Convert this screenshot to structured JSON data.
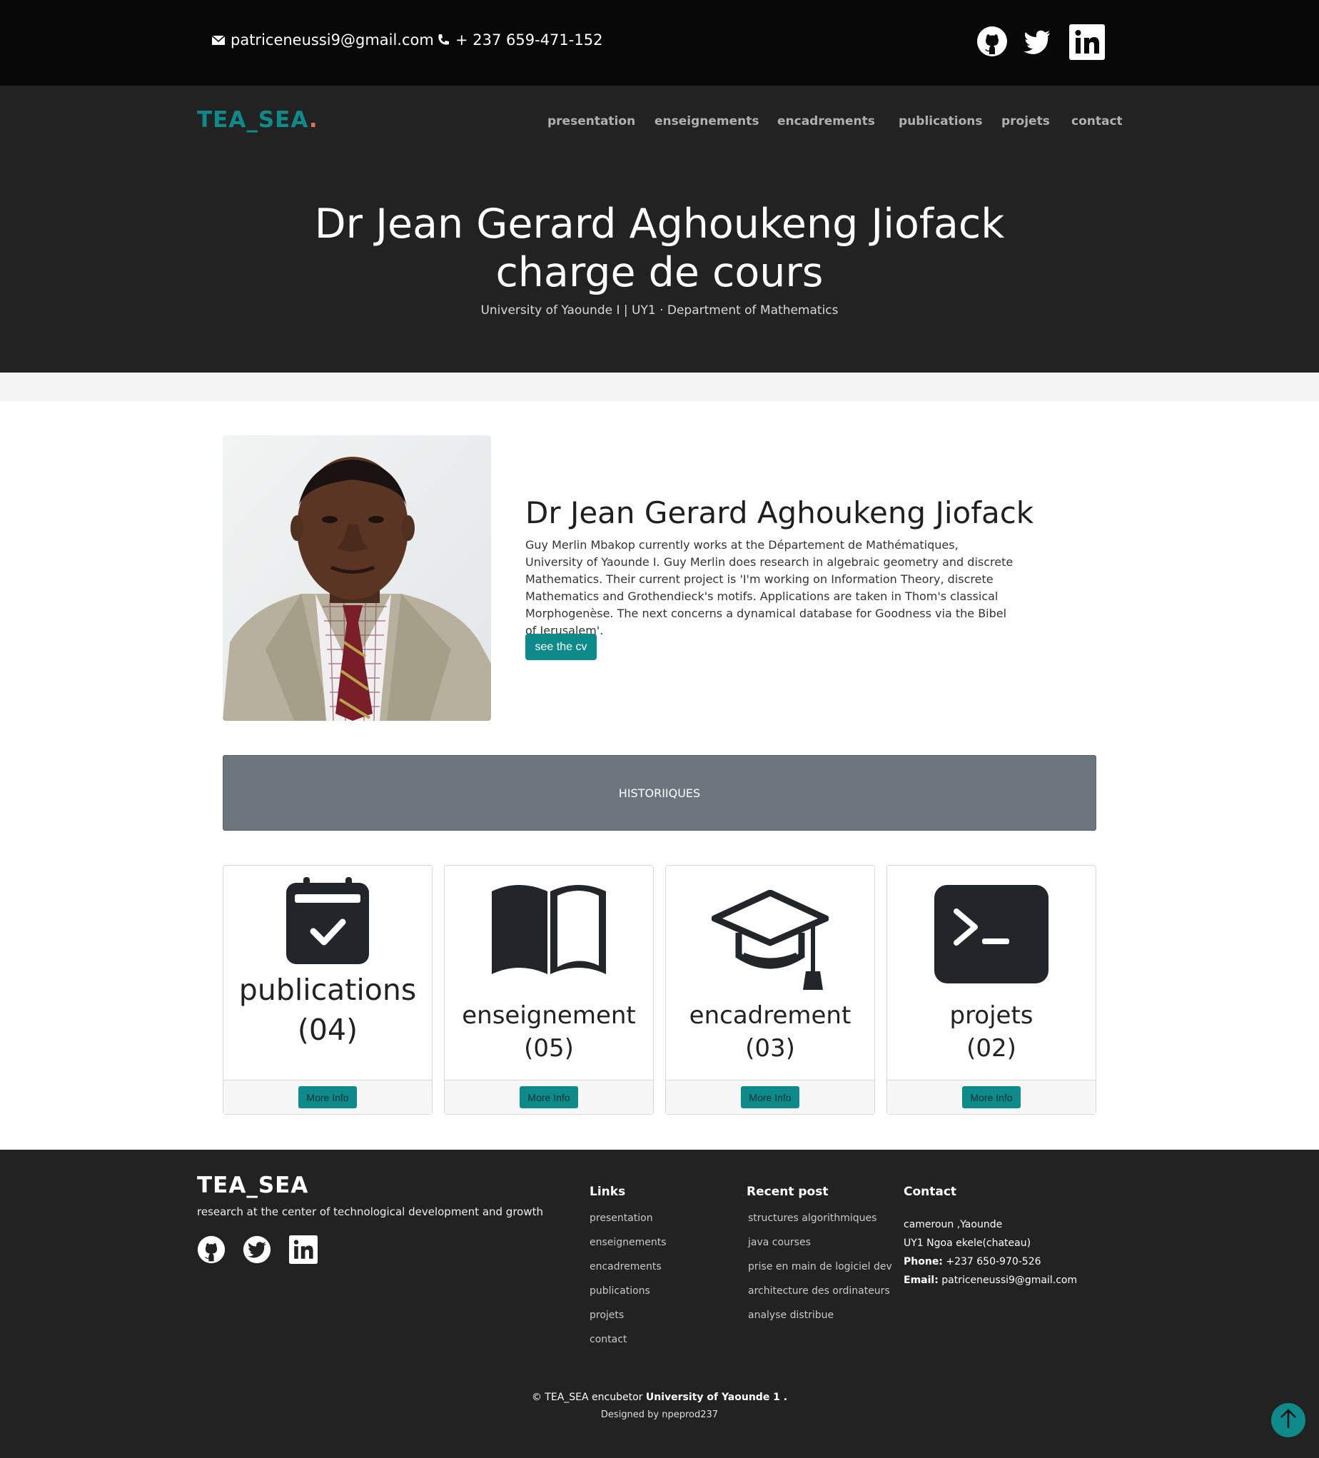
{
  "topbar": {
    "email": "patriceneussi9@gmail.com",
    "phone": "+ 237 659-471-152",
    "social": [
      "github-icon",
      "twitter-icon",
      "linkedin-icon"
    ]
  },
  "header": {
    "logo": "TEA_SEA",
    "logo_dot": ".",
    "nav": [
      "presentation",
      "enseignements",
      "encadrements",
      "publications",
      "projets",
      "contact"
    ],
    "hero_line1": "Dr Jean Gerard Aghoukeng Jiofack",
    "hero_line2": "charge de cours",
    "hero_sub": "University of Yaounde I | UY1 · Department of Mathematics"
  },
  "profile": {
    "name": "Dr Jean Gerard Aghoukeng Jiofack",
    "bio": "Guy Merlin Mbakop currently works at the Département de Mathématiques, University of Yaounde I. Guy Merlin does research in algebraic geometry and discrete Mathematics. Their current project is 'I'm working on Information Theory, discrete Mathematics and Grothendieck's motifs. Applications are taken in Thom's classical Morphogenèse. The next concerns a dynamical database for Goodness via the Bibel of Jerusalem'.",
    "cv_button": "see the cv"
  },
  "history": {
    "label": "HISTORIIQUES"
  },
  "cards": [
    {
      "title": "publications",
      "count": "(04)",
      "button": "More Info",
      "icon": "calendar-check-icon"
    },
    {
      "title": "enseignement",
      "count": "(05)",
      "button": "More Info",
      "icon": "book-icon"
    },
    {
      "title": "encadrement",
      "count": "(03)",
      "button": "More Info",
      "icon": "graduation-cap-icon"
    },
    {
      "title": "projets",
      "count": "(02)",
      "button": "More Info",
      "icon": "terminal-icon"
    }
  ],
  "footer": {
    "logo": "TEA_SEA",
    "tagline": "research at the center of technological development and growth",
    "links_title": "Links",
    "links": [
      "presentation",
      "enseignements",
      "encadrements",
      "publications",
      "projets",
      "contact"
    ],
    "recent_title": "Recent post",
    "recent": [
      "structures algorithmiques",
      "java courses",
      "prise en main de logiciel dev",
      "architecture des ordinateurs",
      "analyse distribue"
    ],
    "contact_title": "Contact",
    "contact_line1": "cameroun ,Yaounde",
    "contact_line2": "UY1 Ngoa ekele(chateau)",
    "phone_label": "Phone:",
    "phone": "+237 650-970-526",
    "email_label": "Email:",
    "email": "patriceneussi9@gmail.com",
    "copyright_prefix": "© TEA_SEA encubetor",
    "copyright_strong": "University of Yaounde 1 .",
    "designed": "Designed by npeprod237"
  },
  "colors": {
    "accent": "#0e8a8a",
    "dot": "#e8734a",
    "dark": "#222222",
    "topbar": "#080808",
    "history": "#6c757d"
  }
}
